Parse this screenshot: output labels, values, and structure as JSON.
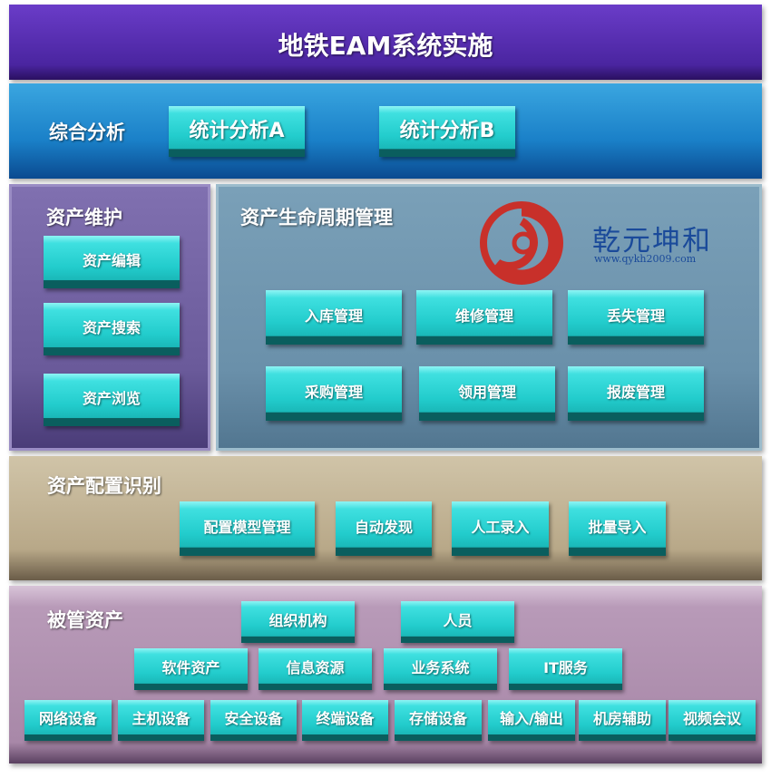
{
  "title": "地铁EAM系统实施",
  "analysis": {
    "label": "综合分析",
    "buttons": [
      "统计分析A",
      "统计分析B"
    ]
  },
  "maintenance": {
    "label": "资产维护",
    "buttons": [
      "资产编辑",
      "资产搜索",
      "资产浏览"
    ]
  },
  "lifecycle": {
    "label": "资产生命周期管理",
    "buttons": [
      "入库管理",
      "维修管理",
      "丢失管理",
      "采购管理",
      "领用管理",
      "报废管理"
    ]
  },
  "logo": {
    "name": "乾元坤和",
    "url": "www.qykh2009.com",
    "color": "#c8302a"
  },
  "config": {
    "label": "资产配置识别",
    "buttons": [
      "配置模型管理",
      "自动发现",
      "人工录入",
      "批量导入"
    ]
  },
  "managed": {
    "label": "被管资产",
    "row1": [
      "组织机构",
      "人员"
    ],
    "row2": [
      "软件资产",
      "信息资源",
      "业务系统",
      "IT服务"
    ],
    "row3": [
      "网络设备",
      "主机设备",
      "安全设备",
      "终端设备",
      "存储设备",
      "输入/输出",
      "机房辅助",
      "视频会议"
    ]
  },
  "colors": {
    "button": "#22cccc",
    "title_bg": "#4a25a0",
    "analysis_bg": "#1a80c8",
    "maintenance_bg": "#6a5a9a",
    "lifecycle_bg": "#6a90aa",
    "config_bg": "#b8a888",
    "managed_bg": "#b89ab8"
  }
}
